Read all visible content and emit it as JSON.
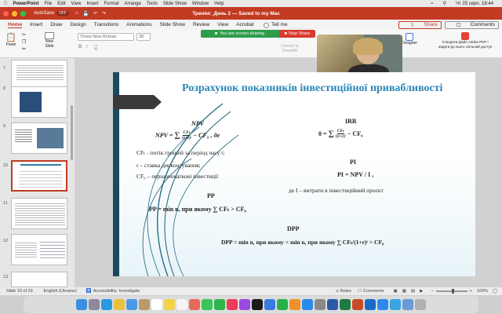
{
  "menubar": {
    "app": "PowerPoint",
    "items": [
      "File",
      "Edit",
      "View",
      "Insert",
      "Format",
      "Arrange",
      "Tools",
      "Slide Show",
      "Window",
      "Help"
    ],
    "clock": "Чт 25 серп. 18:44"
  },
  "titlebar": {
    "autosave": "AutoSave",
    "autosave_state": "OFF",
    "doc_title": "Тренінг_День 2 — Saved to my Mac"
  },
  "ribbon_tabs": [
    "Home",
    "Insert",
    "Draw",
    "Design",
    "Transitions",
    "Animations",
    "Slide Show",
    "Review",
    "View",
    "Acrobat"
  ],
  "tell_me": "Tell me",
  "share_label": "Share",
  "comments_label": "Comments",
  "screen_share": {
    "status": "You are screen sharing.",
    "stop": "Stop Share"
  },
  "ribbon": {
    "paste": "Paste",
    "new_slide": "New\nSlide",
    "font_name": "Times New Roman",
    "font_size": "28",
    "convert": "Convert to\nSmartArt",
    "designer": "Designer",
    "adobe": "Створити файл Adobe PDF і\nнадати до нього спільний доступ"
  },
  "thumbnails": [
    {
      "num": "7"
    },
    {
      "num": "8"
    },
    {
      "num": "9"
    },
    {
      "num": "10"
    },
    {
      "num": "11"
    },
    {
      "num": "12"
    },
    {
      "num": "13"
    }
  ],
  "slide": {
    "title": "Розрахунок показників інвестиційної привабливості",
    "npv_heading": "NPV",
    "npv_formula_lhs": "NPV = ",
    "npv_formula_rhs": "− CF₀ ,  де",
    "cf_def": "CFₜ - потік грошей за період часу t;",
    "r_def": "r – ставка дисконтування;",
    "cf0_def": "CF₀ – першопочаткові інвестиції",
    "irr_heading": "IRR",
    "irr_formula_lhs": "0 = ",
    "irr_formula_rhs": "− CF₀",
    "pi_heading": "PI",
    "pi_formula": "PI = NPV / I ,",
    "pi_def": "де I – витрати в інвестиційний проєкт",
    "pp_heading": "PP",
    "pp_formula": "PP = min n, при якому ∑ CFₜ > CF₀",
    "dpp_heading": "DPP",
    "dpp_formula": "DPP = min n, при якому = min n, при якому ∑ CFₜ/(1+r)ᵗ > CF₀"
  },
  "statusbar": {
    "slide_of": "Slide 10 of 29",
    "language": "English (Ukraine)",
    "accessibility": "Accessibility: Investigate",
    "notes": "Notes",
    "comments": "Comments",
    "zoom": "109%"
  }
}
